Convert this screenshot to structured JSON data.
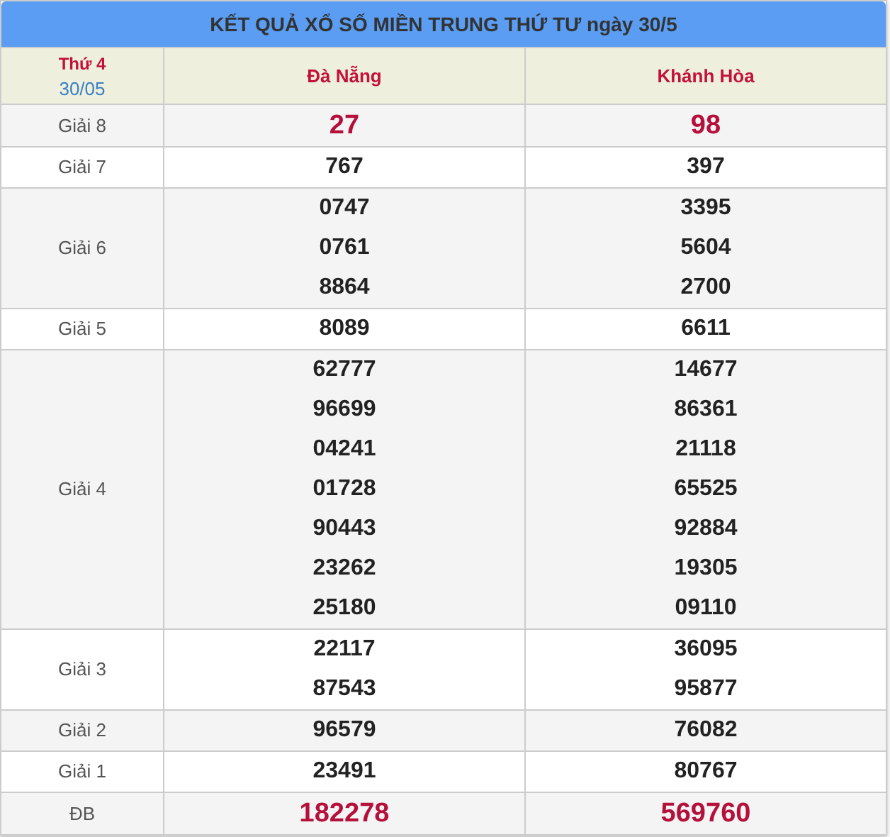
{
  "title": "KẾT QUẢ XỔ SỐ MIỀN TRUNG THỨ TƯ ngày 30/5",
  "day": {
    "weekday": "Thứ 4",
    "date": "30/05"
  },
  "provinces": [
    "Đà Nẵng",
    "Khánh Hòa"
  ],
  "rows": [
    {
      "label": "Giải 8",
      "kind": "highlight",
      "results": [
        [
          "27"
        ],
        [
          "98"
        ]
      ]
    },
    {
      "label": "Giải 7",
      "kind": "plain",
      "results": [
        [
          "767"
        ],
        [
          "397"
        ]
      ]
    },
    {
      "label": "Giải 6",
      "kind": "plain",
      "results": [
        [
          "0747",
          "0761",
          "8864"
        ],
        [
          "3395",
          "5604",
          "2700"
        ]
      ]
    },
    {
      "label": "Giải 5",
      "kind": "plain",
      "results": [
        [
          "8089"
        ],
        [
          "6611"
        ]
      ]
    },
    {
      "label": "Giải 4",
      "kind": "plain",
      "results": [
        [
          "62777",
          "96699",
          "04241",
          "01728",
          "90443",
          "23262",
          "25180"
        ],
        [
          "14677",
          "86361",
          "21118",
          "65525",
          "92884",
          "19305",
          "09110"
        ]
      ]
    },
    {
      "label": "Giải 3",
      "kind": "plain",
      "results": [
        [
          "22117",
          "87543"
        ],
        [
          "36095",
          "95877"
        ]
      ]
    },
    {
      "label": "Giải 2",
      "kind": "plain",
      "results": [
        [
          "96579"
        ],
        [
          "76082"
        ]
      ]
    },
    {
      "label": "Giải 1",
      "kind": "plain",
      "results": [
        [
          "23491"
        ],
        [
          "80767"
        ]
      ]
    },
    {
      "label": "ĐB",
      "kind": "highlight",
      "results": [
        [
          "182278"
        ],
        [
          "569760"
        ]
      ]
    }
  ]
}
